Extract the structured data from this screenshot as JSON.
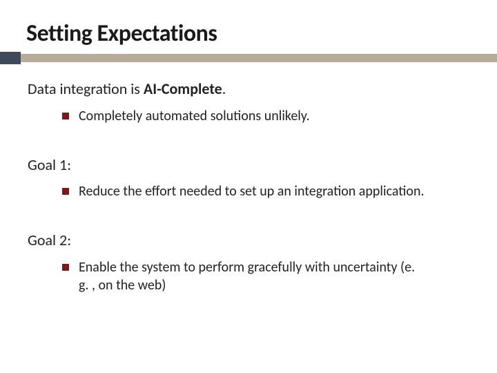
{
  "slide": {
    "title": "Setting Expectations",
    "section1": {
      "pre": "Data integration is ",
      "bold": "AI-Complete",
      "post": ".",
      "bullet": "Completely automated solutions unlikely."
    },
    "section2": {
      "label": "Goal 1:",
      "bullet": "Reduce the effort needed to set up an integration application."
    },
    "section3": {
      "label": "Goal 2:",
      "bullet": "Enable the system to perform gracefully with uncertainty (e. g. , on the web)"
    }
  }
}
